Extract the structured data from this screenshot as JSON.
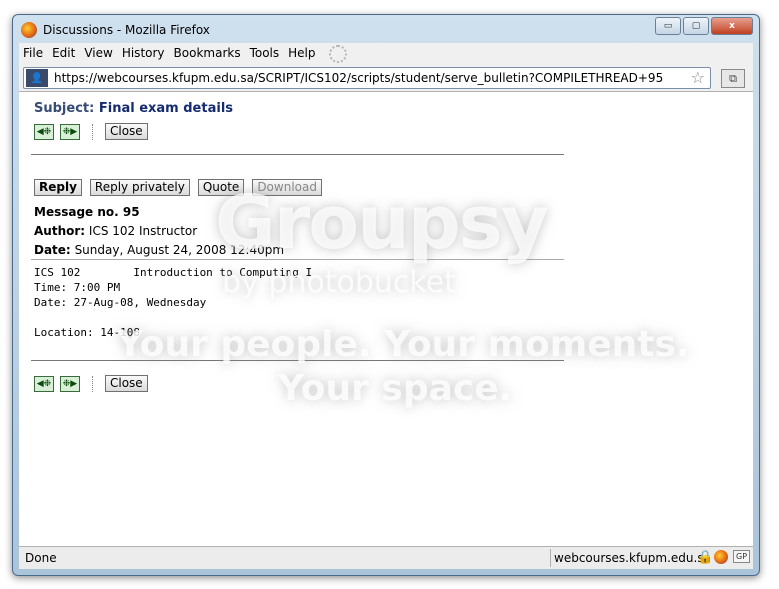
{
  "window": {
    "title": "Discussions - Mozilla Firefox",
    "controls": {
      "minimize": "▭",
      "maximize": "▢",
      "close": "x"
    }
  },
  "menu": [
    "File",
    "Edit",
    "View",
    "History",
    "Bookmarks",
    "Tools",
    "Help"
  ],
  "address": {
    "url": "https://webcourses.kfupm.edu.sa/SCRIPT/ICS102/scripts/student/serve_bulletin?COMPILETHREAD+95"
  },
  "page": {
    "subject_label": "Subject:",
    "subject_value": "Final exam details",
    "close_label": "Close",
    "actions": {
      "reply": "Reply",
      "reply_privately": "Reply privately",
      "quote": "Quote",
      "download": "Download"
    },
    "message_no": "Message no. 95",
    "author_label": "Author:",
    "author_value": "ICS 102 Instructor",
    "date_label": "Date:",
    "date_value": "Sunday, August 24, 2008 12:40pm",
    "body": "ICS 102        Introduction to Computing I\nTime: 7:00 PM\nDate: 27-Aug-08, Wednesday\n\nLocation: 14-108"
  },
  "watermark": {
    "logo": "Groupsy",
    "sub": "by photobucket",
    "line1": "Your people. Your moments.",
    "line2": "Your space."
  },
  "status": {
    "text": "Done",
    "site": "webcourses.kfupm.edu.sa",
    "badge": "GP"
  }
}
